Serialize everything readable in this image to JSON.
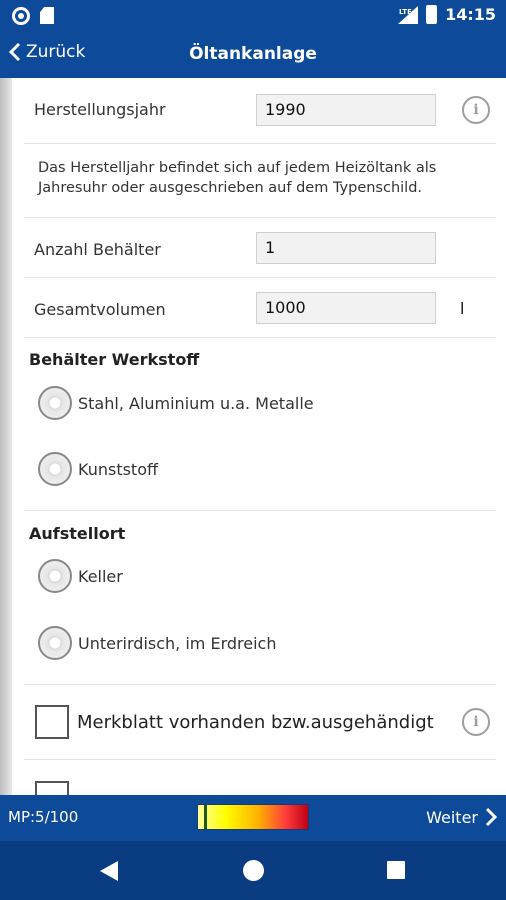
{
  "status_bar": {
    "time": "14:15",
    "network": "LTE",
    "icons": [
      "record-icon",
      "sd-card-icon",
      "signal-icon",
      "battery-icon"
    ]
  },
  "app_bar": {
    "back_label": "Zurück",
    "title": "Öltankanlage"
  },
  "form": {
    "year": {
      "label": "Herstellungsjahr",
      "value": "1990"
    },
    "hint": "Das Herstelljahr befindet sich auf jedem Heizöltank als Jahresuhr oder ausgeschrieben auf dem Typenschild.",
    "count": {
      "label": "Anzahl Behälter",
      "value": "1"
    },
    "volume": {
      "label": "Gesamtvolumen",
      "value": "1000",
      "unit": "l"
    },
    "material": {
      "title": "Behälter Werkstoff",
      "options": [
        "Stahl, Aluminium u.a. Metalle",
        "Kunststoff"
      ]
    },
    "location": {
      "title": "Aufstellort",
      "options": [
        "Keller",
        "Unterirdisch, im Erdreich"
      ]
    },
    "checkbox": {
      "label": "Merkblatt vorhanden bzw.ausgehändigt"
    }
  },
  "bottom_bar": {
    "mp_label": "MP:5/100",
    "meter_level": 0.05,
    "next_label": "Weiter"
  },
  "colors": {
    "primary": "#0d4a9a",
    "navbar": "#0a3c82"
  }
}
